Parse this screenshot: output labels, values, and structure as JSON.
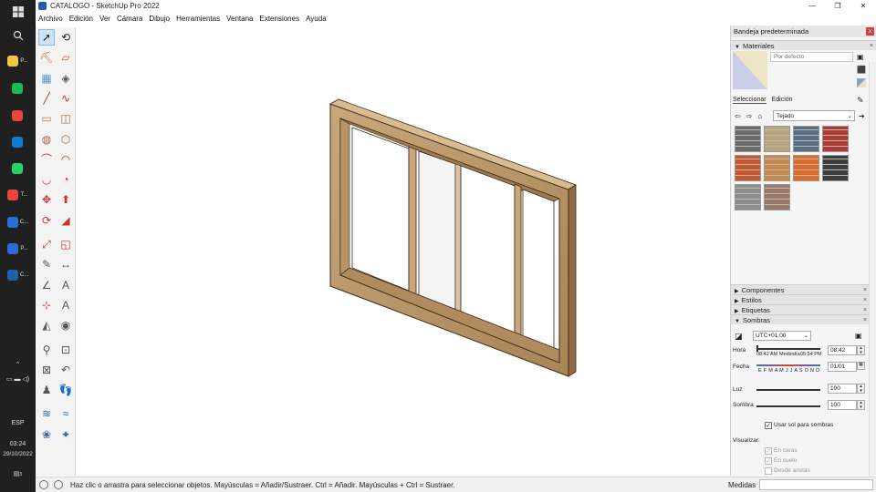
{
  "taskbar": {
    "items": [
      {
        "label": "P...",
        "color": "#f4c542"
      },
      {
        "label": "",
        "color": "#1db954"
      },
      {
        "label": "",
        "color": "#e8453c"
      },
      {
        "label": "",
        "color": "#0f7bd3"
      },
      {
        "label": "",
        "color": "#25d366"
      },
      {
        "label": "T...",
        "color": "#e8453c"
      },
      {
        "label": "C...",
        "color": "#2b6cd8"
      },
      {
        "label": "P...",
        "color": "#2b6cd8"
      },
      {
        "label": "C...",
        "color": "#1f5ea8"
      }
    ],
    "lang": "ESP",
    "time": "03:24",
    "date": "29/10/2022",
    "notif_count": "3"
  },
  "window": {
    "title": "CATALOGO - SketchUp Pro 2022",
    "min": "—",
    "max": "❐",
    "close": "✕"
  },
  "menu": [
    "Archivo",
    "Edición",
    "Ver",
    "Cámara",
    "Dibujo",
    "Herramientas",
    "Ventana",
    "Extensiones",
    "Ayuda"
  ],
  "status": {
    "text": "Haz clic o arrastra para seleccionar objetos. Mayúsculas = Añadir/Sustraer. Ctrl = Añadir. Mayúsculas + Ctrl = Sustraer.",
    "measure_label": "Medidas",
    "measure_value": ""
  },
  "tray": {
    "title": "Bandeja predeterminada",
    "close": "x",
    "materials": {
      "header": "Materiales",
      "name_placeholder": "Por defecto",
      "tab_select": "Seleccionar",
      "tab_edit": "Edición",
      "library": "Tejado",
      "swatch_colors": [
        "#6b6b6b",
        "#b8a67a",
        "#5a6e82",
        "#b03a32",
        "#c4572d",
        "#c88a4e",
        "#e06a2a",
        "#3c3c3c",
        "#8d8d8d",
        "#9a7a66"
      ]
    },
    "sections": [
      "Componentes",
      "Estilos",
      "Etiquetas",
      "Sombras"
    ],
    "sombras": {
      "timezone": "UTC+01:00",
      "hora_label": "Hora",
      "hora_value": "08:42",
      "hora_am": "08:42 AM",
      "hora_mid": "Mediodía",
      "hora_pm": "05:54 PM",
      "fecha_label": "Fecha",
      "fecha_value": "01/01",
      "months": "E F M A M J J A S O N D",
      "luz_label": "Luz",
      "luz_value": "100",
      "sombra_label": "Sombra",
      "sombra_value": "100",
      "use_sun": "Usar sol para sombras",
      "visualizar": "Visualizar:",
      "en_caras": "En caras",
      "en_suelo": "En suelo",
      "desde_aristas": "Desde aristas"
    }
  }
}
